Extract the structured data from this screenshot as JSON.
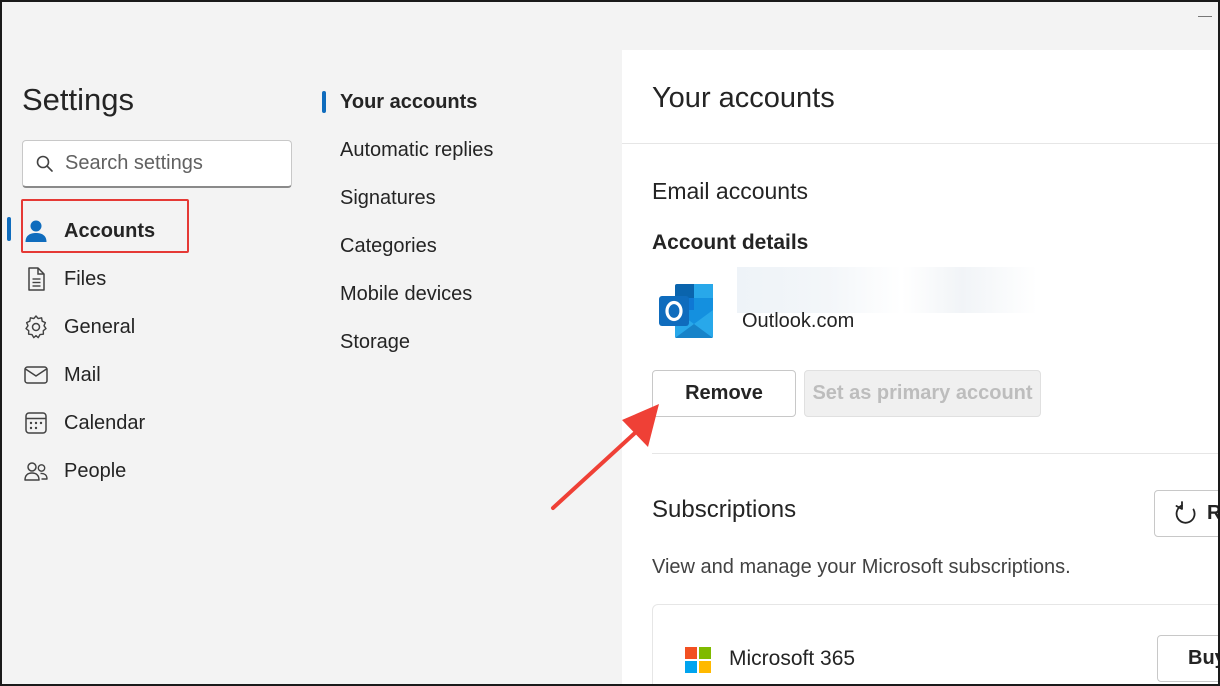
{
  "window": {
    "title": "Settings"
  },
  "search": {
    "placeholder": "Search settings"
  },
  "nav": {
    "items": [
      {
        "label": "Accounts",
        "icon": "person-icon"
      },
      {
        "label": "Files",
        "icon": "document-icon"
      },
      {
        "label": "General",
        "icon": "gear-icon"
      },
      {
        "label": "Mail",
        "icon": "mail-icon"
      },
      {
        "label": "Calendar",
        "icon": "calendar-icon"
      },
      {
        "label": "People",
        "icon": "people-icon"
      }
    ]
  },
  "subnav": {
    "items": [
      {
        "label": "Your accounts"
      },
      {
        "label": "Automatic replies"
      },
      {
        "label": "Signatures"
      },
      {
        "label": "Categories"
      },
      {
        "label": "Mobile devices"
      },
      {
        "label": "Storage"
      }
    ]
  },
  "content": {
    "title": "Your accounts",
    "email_heading": "Email accounts",
    "details_heading": "Account details",
    "account_type": "Outlook.com",
    "remove_label": "Remove",
    "primary_label": "Set as primary account",
    "subs_heading": "Subscriptions",
    "refresh_label": "Refresh",
    "subs_desc": "View and manage your Microsoft subscriptions.",
    "sub_name": "Microsoft 365",
    "buy_label": "Buy"
  },
  "colors": {
    "accent": "#0f6cbd",
    "highlight": "#e53935",
    "outlook_blue": "#0a64ad"
  }
}
